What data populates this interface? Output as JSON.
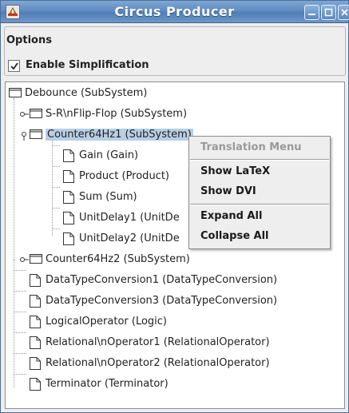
{
  "window": {
    "title": "Circus Producer",
    "buttons": {
      "minimize": "minimize-icon",
      "maximize": "maximize-icon",
      "close": "close-icon"
    }
  },
  "options": {
    "group_title": "Options",
    "enable_simplification_label": "Enable Simplification",
    "enable_simplification_checked": true
  },
  "tree": {
    "nodes": [
      {
        "label": "Debounce (SubSystem)",
        "type": "folder",
        "depth": 0,
        "expanded": true
      },
      {
        "label": "S-R\\nFlip-Flop (SubSystem)",
        "type": "folder",
        "depth": 1,
        "expanded": false
      },
      {
        "label": "Counter64Hz1 (SubSystem)",
        "type": "folder",
        "depth": 1,
        "expanded": true,
        "selected": true
      },
      {
        "label": "Gain (Gain)",
        "type": "file",
        "depth": 2
      },
      {
        "label": "Product (Product)",
        "type": "file",
        "depth": 2
      },
      {
        "label": "Sum (Sum)",
        "type": "file",
        "depth": 2
      },
      {
        "label": "UnitDelay1 (UnitDe",
        "type": "file",
        "depth": 2
      },
      {
        "label": "UnitDelay2 (UnitDe",
        "type": "file",
        "depth": 2
      },
      {
        "label": "Counter64Hz2 (SubSystem)",
        "type": "folder",
        "depth": 1,
        "expanded": false
      },
      {
        "label": "DataTypeConversion1 (DataTypeConversion)",
        "type": "file",
        "depth": 1
      },
      {
        "label": "DataTypeConversion3 (DataTypeConversion)",
        "type": "file",
        "depth": 1
      },
      {
        "label": "LogicalOperator (Logic)",
        "type": "file",
        "depth": 1
      },
      {
        "label": "Relational\\nOperator1 (RelationalOperator)",
        "type": "file",
        "depth": 1
      },
      {
        "label": "Relational\\nOperator2 (RelationalOperator)",
        "type": "file",
        "depth": 1
      },
      {
        "label": "Terminator (Terminator)",
        "type": "file",
        "depth": 1
      }
    ]
  },
  "context_menu": {
    "header": "Translation Menu",
    "items": [
      "Show LaTeX",
      "Show DVI",
      "Expand All",
      "Collapse All"
    ]
  },
  "colors": {
    "titlebar": "#5f8cc2",
    "selection": "#b8cfe5",
    "menu_header": "#9a9a9a"
  }
}
